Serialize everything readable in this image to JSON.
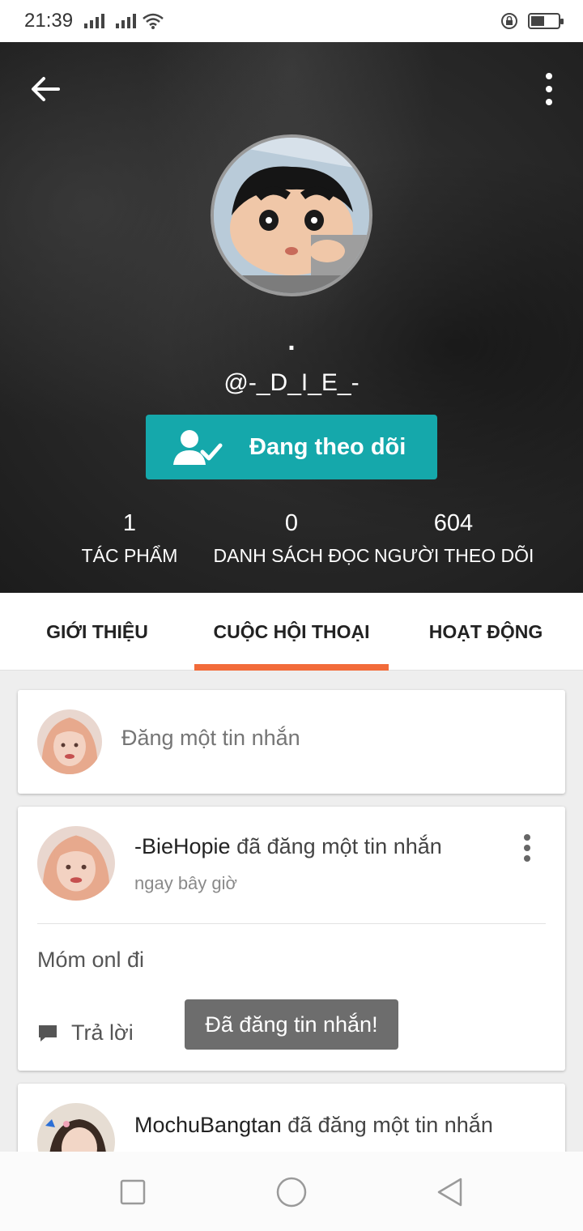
{
  "status_bar": {
    "time": "21:39"
  },
  "profile": {
    "display_name": ".",
    "username": "@-_D_I_E_-",
    "follow_button_label": "Đang theo dõi"
  },
  "stats": [
    {
      "value": "1",
      "label": "TÁC PHẨM"
    },
    {
      "value": "0",
      "label": "DANH SÁCH ĐỌC"
    },
    {
      "value": "604",
      "label": "NGƯỜI THEO DÕI"
    }
  ],
  "tabs": [
    {
      "label": "GIỚI THIỆU"
    },
    {
      "label": "CUỘC HỘI THOẠI",
      "active": true
    },
    {
      "label": "HOẠT ĐỘNG"
    }
  ],
  "post_box": {
    "placeholder": "Đăng một tin nhắn"
  },
  "messages": [
    {
      "author": "-BieHopie",
      "action": " đã đăng một tin nhắn",
      "time": "ngay bây giờ",
      "body": "Móm onl đi",
      "reply_label": "Trả lời"
    },
    {
      "author": "MochuBangtan",
      "action": " đã đăng một tin nhắn"
    }
  ],
  "toast": "Đã đăng tin nhắn!",
  "colors": {
    "accent_teal": "#15a8ab",
    "tab_indicator": "#f26b3a"
  }
}
